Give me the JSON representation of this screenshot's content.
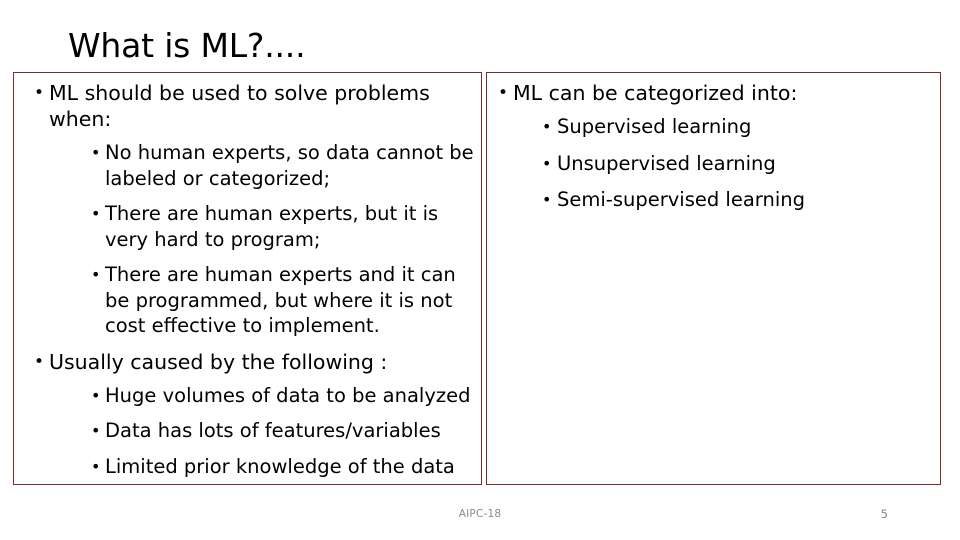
{
  "slide": {
    "title": "What is ML?....",
    "accent_color": "#7b2b2b",
    "footer_color": "#8b8b8b",
    "text_color": "#000000",
    "background_color": "#ffffff"
  },
  "left_box": {
    "bullets": [
      {
        "text": "ML should be used to solve problems when:",
        "children": [
          {
            "text": "No human experts, so data cannot be labeled or categorized;"
          },
          {
            "text": "There are human experts, but it is very hard to program;"
          },
          {
            "text": "There are human experts and it can be programmed, but where it is not cost effective to implement."
          }
        ]
      },
      {
        "text": "Usually caused by the following :",
        "children": [
          {
            "text": "Huge volumes of data to be analyzed"
          },
          {
            "text": "Data has lots of features/variables"
          },
          {
            "text": "Limited prior knowledge of the data"
          }
        ]
      }
    ]
  },
  "right_box": {
    "bullets": [
      {
        "text": "ML can be categorized into:",
        "children": [
          {
            "text": "Supervised learning"
          },
          {
            "text": "Unsupervised learning"
          },
          {
            "text": "Semi-supervised learning"
          }
        ]
      }
    ]
  },
  "footer": {
    "center_label": "AIPC-18",
    "page_number": "5"
  },
  "bullet_glyph": "•"
}
